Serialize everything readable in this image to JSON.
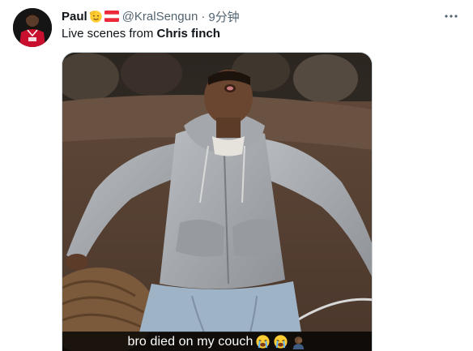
{
  "tweet": {
    "author": {
      "display_name": "Paul",
      "name_emojis": [
        "salute-face-emoji",
        "austria-flag-emoji"
      ],
      "handle": "@KralSengun",
      "separator": "·",
      "timestamp": "9分钟"
    },
    "more_icon": "more-horizontal-icon",
    "text_prefix": "Live scenes from ",
    "text_bold": "Chris finch",
    "media": {
      "caption": "bro died on my couch",
      "caption_emojis": [
        "loudly-crying-face-emoji",
        "loudly-crying-face-emoji",
        "man-facepalming-emoji"
      ]
    }
  },
  "colors": {
    "primary_text": "#0f1419",
    "secondary_text": "#536471",
    "border": "#cfd9de"
  }
}
